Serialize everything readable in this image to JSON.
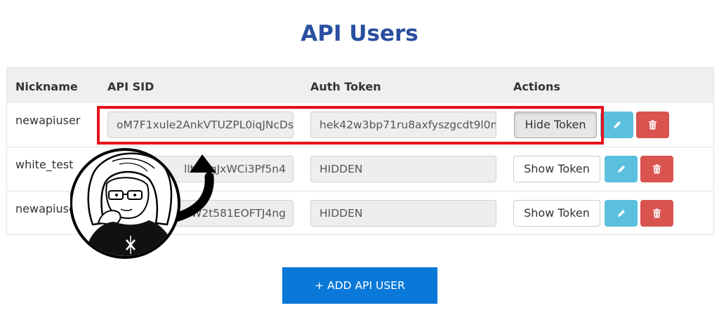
{
  "page": {
    "title": "API Users"
  },
  "table": {
    "headers": [
      "Nickname",
      "API SID",
      "Auth Token",
      "Actions"
    ],
    "rows": [
      {
        "nickname": "newapiuser",
        "api_sid": "oM7F1xule2AnkVTUZPL0iqJNcDs",
        "auth_token": "hek42w3bp71ru8axfyszgcdt9l0n",
        "token_button": "Hide Token"
      },
      {
        "nickname": "white_test",
        "api_sid": "lltOqgJxWCi3Pf5n4",
        "auth_token": "HIDDEN",
        "token_button": "Show Token"
      },
      {
        "nickname": "newapiuse",
        "api_sid": "kW2t581EOFTJ4ng",
        "auth_token": "HIDDEN",
        "token_button": "Show Token"
      }
    ]
  },
  "add_button": {
    "label": "+ ADD API USER"
  },
  "icons": {
    "edit": "pencil-icon",
    "delete": "trash-icon"
  },
  "colors": {
    "title": "#2a4fa0",
    "edit_button": "#5bc0de",
    "delete_button": "#d9534f",
    "add_button": "#0a78d8",
    "highlight": "#e8101a"
  }
}
